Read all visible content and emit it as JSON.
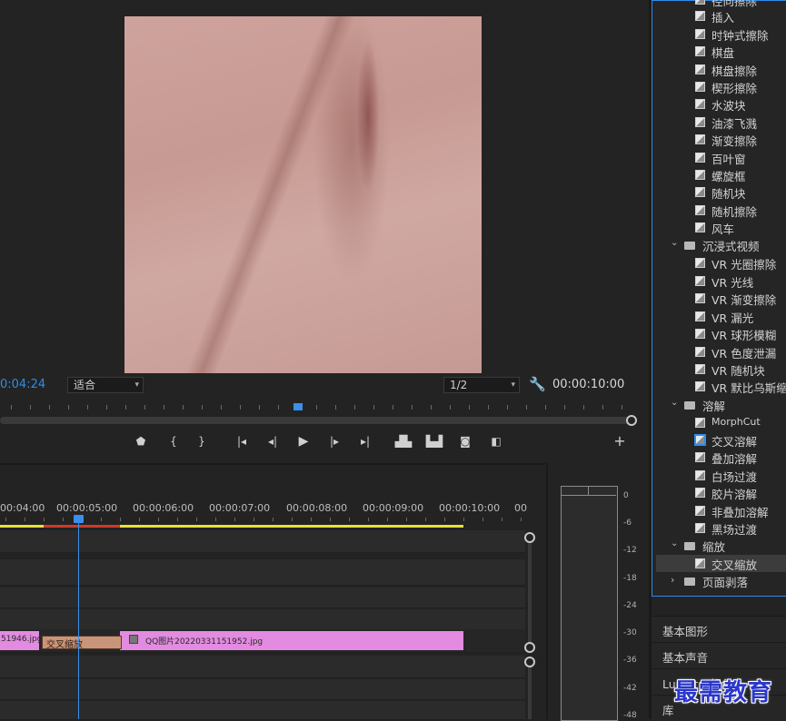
{
  "monitor": {
    "current_timecode": "0:04:24",
    "fit_label": "适合",
    "resolution_label": "1/2",
    "duration_timecode": "00:00:10:00"
  },
  "timeline": {
    "time_labels": [
      "00:04:00",
      "00:00:05:00",
      "00:00:06:00",
      "00:00:07:00",
      "00:00:08:00",
      "00:00:09:00",
      "00:00:10:00",
      "00"
    ],
    "clip_left_name": "51946.jpg",
    "transition_name": "交叉缩放",
    "clip_right_name": "QQ图片20220331151952.jpg"
  },
  "meter": {
    "db_labels": [
      "0",
      "-6",
      "-12",
      "-18",
      "-24",
      "-30",
      "-36",
      "-42",
      "-48"
    ]
  },
  "effects": {
    "items_top": [
      {
        "type": "item",
        "label": "径向擦除"
      },
      {
        "type": "item",
        "label": "插入"
      },
      {
        "type": "item",
        "label": "时钟式擦除"
      },
      {
        "type": "item",
        "label": "棋盘"
      },
      {
        "type": "item",
        "label": "棋盘擦除"
      },
      {
        "type": "item",
        "label": "楔形擦除"
      },
      {
        "type": "item",
        "label": "水波块"
      },
      {
        "type": "item",
        "label": "油漆飞溅"
      },
      {
        "type": "item",
        "label": "渐变擦除"
      },
      {
        "type": "item",
        "label": "百叶窗"
      },
      {
        "type": "item",
        "label": "螺旋框"
      },
      {
        "type": "item",
        "label": "随机块"
      },
      {
        "type": "item",
        "label": "随机擦除"
      },
      {
        "type": "item",
        "label": "风车"
      },
      {
        "type": "folder",
        "label": "沉浸式视频",
        "open": true
      },
      {
        "type": "item",
        "label": "VR 光圈擦除"
      },
      {
        "type": "item",
        "label": "VR 光线"
      },
      {
        "type": "item",
        "label": "VR 渐变擦除"
      },
      {
        "type": "item",
        "label": "VR 漏光"
      },
      {
        "type": "item",
        "label": "VR 球形模糊"
      },
      {
        "type": "item",
        "label": "VR 色度泄漏"
      },
      {
        "type": "item",
        "label": "VR 随机块"
      },
      {
        "type": "item",
        "label": "VR 默比乌斯缩放"
      },
      {
        "type": "folder",
        "label": "溶解",
        "open": true
      },
      {
        "type": "item",
        "label": "MorphCut"
      },
      {
        "type": "item",
        "label": "交叉溶解"
      },
      {
        "type": "item",
        "label": "叠加溶解"
      },
      {
        "type": "item",
        "label": "白场过渡"
      },
      {
        "type": "item",
        "label": "胶片溶解"
      },
      {
        "type": "item",
        "label": "非叠加溶解"
      },
      {
        "type": "item",
        "label": "黑场过渡"
      },
      {
        "type": "folder",
        "label": "缩放",
        "open": true
      },
      {
        "type": "item",
        "label": "交叉缩放",
        "selected": true
      },
      {
        "type": "folder",
        "label": "页面剥落",
        "open": false
      }
    ],
    "panels": [
      "基本图形",
      "基本声音",
      "Lumetri 颜色",
      "库"
    ]
  },
  "watermark": "最需教育"
}
